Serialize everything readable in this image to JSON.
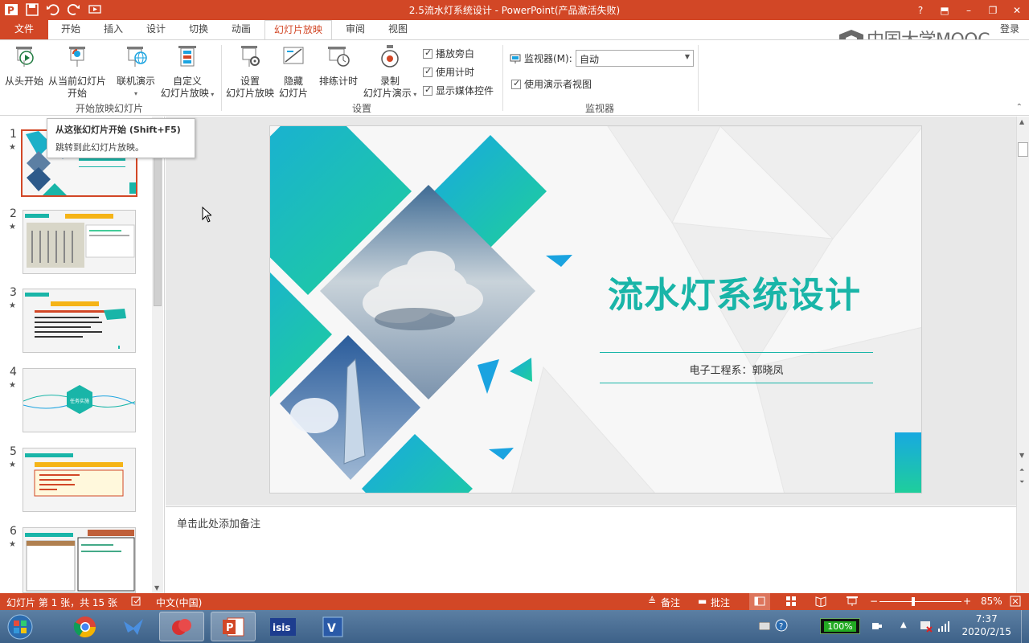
{
  "window": {
    "title": "2.5流水灯系统设计 -  PowerPoint(产品激活失败)",
    "controls": [
      "?",
      "⬒",
      "–",
      "❐",
      "✕"
    ]
  },
  "tabs": {
    "file": "文件",
    "items": [
      "开始",
      "插入",
      "设计",
      "切换",
      "动画",
      "幻灯片放映",
      "审阅",
      "视图"
    ],
    "active": "幻灯片放映",
    "login": "登录"
  },
  "brand": {
    "text": "中国大学MOOC"
  },
  "ribbon": {
    "start_group": {
      "label": "开始放映幻灯片",
      "from_start": "从头开始",
      "from_current_line1": "从当前幻灯片",
      "from_current_line2": "开始",
      "online_line1": "联机演示",
      "custom_line1": "自定义",
      "custom_line2": "幻灯片放映"
    },
    "setup_group": {
      "label": "设置",
      "setup_line1": "设置",
      "setup_line2": "幻灯片放映",
      "hide_line1": "隐藏",
      "hide_line2": "幻灯片",
      "rehearse": "排练计时",
      "record_line1": "录制",
      "record_line2": "幻灯片演示",
      "play_narration": "播放旁白",
      "use_timings": "使用计时",
      "show_media": "显示媒体控件"
    },
    "monitor_group": {
      "label": "监视器",
      "monitor_label": "监视器(M):",
      "monitor_value": "自动",
      "presenter_view": "使用演示者视图"
    }
  },
  "tooltip": {
    "title": "从这张幻灯片开始 (Shift+F5)",
    "desc": "跳转到此幻灯片放映。"
  },
  "thumbnails": {
    "nums": [
      "1",
      "2",
      "3",
      "4",
      "5",
      "6"
    ],
    "star": "★",
    "slide4_text": "任务实施"
  },
  "slide": {
    "title": "流水灯系统设计",
    "subtitle": "电子工程系：郭晓凤"
  },
  "notes": {
    "placeholder": "单击此处添加备注"
  },
  "statusbar": {
    "slide_info": "幻灯片 第 1 张，共 15 张",
    "language": "中文(中国)",
    "notes": "备注",
    "comments": "批注",
    "zoom": "85%"
  },
  "taskbar": {
    "battery": "100%",
    "time": "7:37",
    "date": "2020/2/15"
  },
  "colors": {
    "accent": "#d24726",
    "teal": "#1dbfa5",
    "blue": "#1aa3e0",
    "title_teal": "#19b5a8"
  }
}
